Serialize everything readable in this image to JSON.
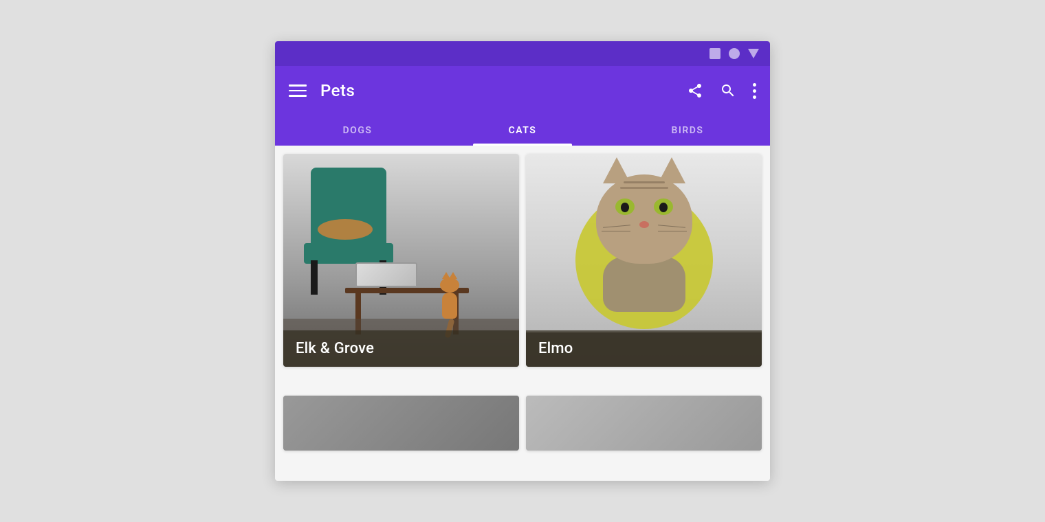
{
  "statusBar": {
    "icons": [
      "square",
      "circle",
      "triangle"
    ]
  },
  "appBar": {
    "title": "Pets",
    "actions": {
      "share": "share",
      "search": "search",
      "more": "more"
    }
  },
  "tabs": [
    {
      "id": "dogs",
      "label": "DOGS",
      "active": false
    },
    {
      "id": "cats",
      "label": "CATS",
      "active": true
    },
    {
      "id": "birds",
      "label": "BIRDS",
      "active": false
    }
  ],
  "cards": [
    {
      "id": "elk-grove",
      "title": "Elk & Grove",
      "type": "two-cats-room"
    },
    {
      "id": "elmo",
      "title": "Elmo",
      "type": "cat-portrait"
    }
  ],
  "colors": {
    "primary": "#6c35de",
    "statusBar": "#5c2ec7",
    "activeTab": "#ffffff",
    "inactiveTab": "rgba(255,255,255,0.65)",
    "cardLabelBg": "rgba(50,45,30,0.72)"
  }
}
